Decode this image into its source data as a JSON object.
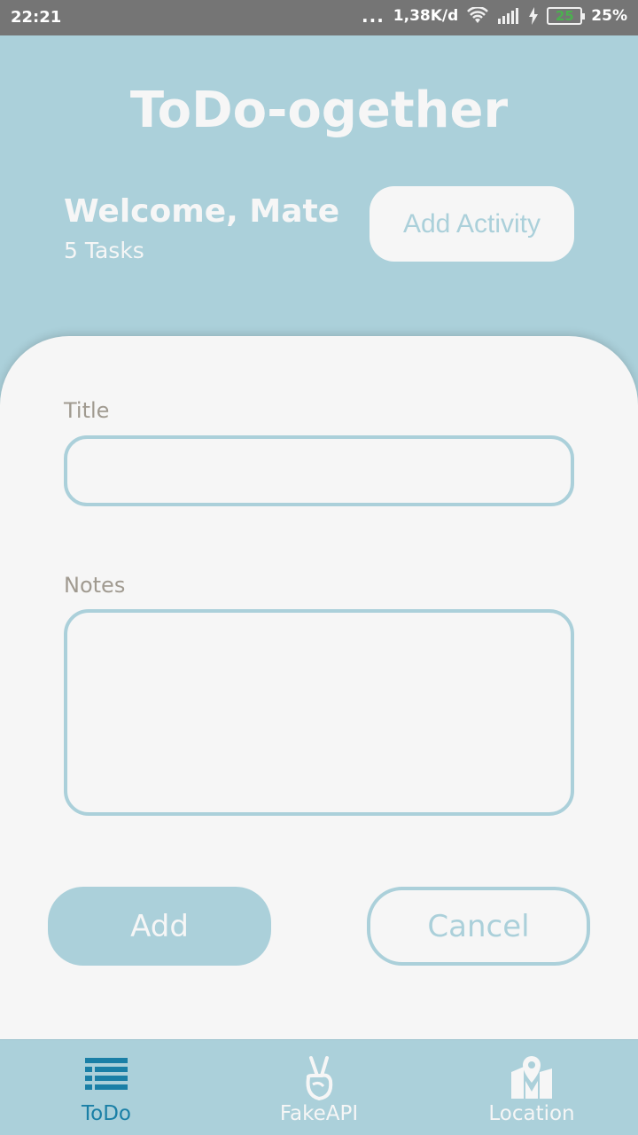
{
  "status_bar": {
    "time": "22:21",
    "dots": "...",
    "network_speed": "1,38K/d",
    "battery_level": "25",
    "battery_percent": "25%"
  },
  "header": {
    "app_title": "ToDo-ogether",
    "welcome": "Welcome, Mate",
    "task_count": "5 Tasks",
    "add_activity_label": "Add Activity"
  },
  "form": {
    "title_label": "Title",
    "title_value": "",
    "notes_label": "Notes",
    "notes_value": "",
    "add_label": "Add",
    "cancel_label": "Cancel"
  },
  "bottom_nav": {
    "items": [
      {
        "label": "ToDo",
        "icon": "list-icon",
        "active": true
      },
      {
        "label": "FakeAPI",
        "icon": "peace-hand-icon",
        "active": false
      },
      {
        "label": "Location",
        "icon": "map-pin-icon",
        "active": false
      }
    ]
  },
  "colors": {
    "accent": "#abd0da",
    "active_nav": "#1a7fa6",
    "sheet": "#f6f6f6",
    "label": "#a09a90"
  }
}
